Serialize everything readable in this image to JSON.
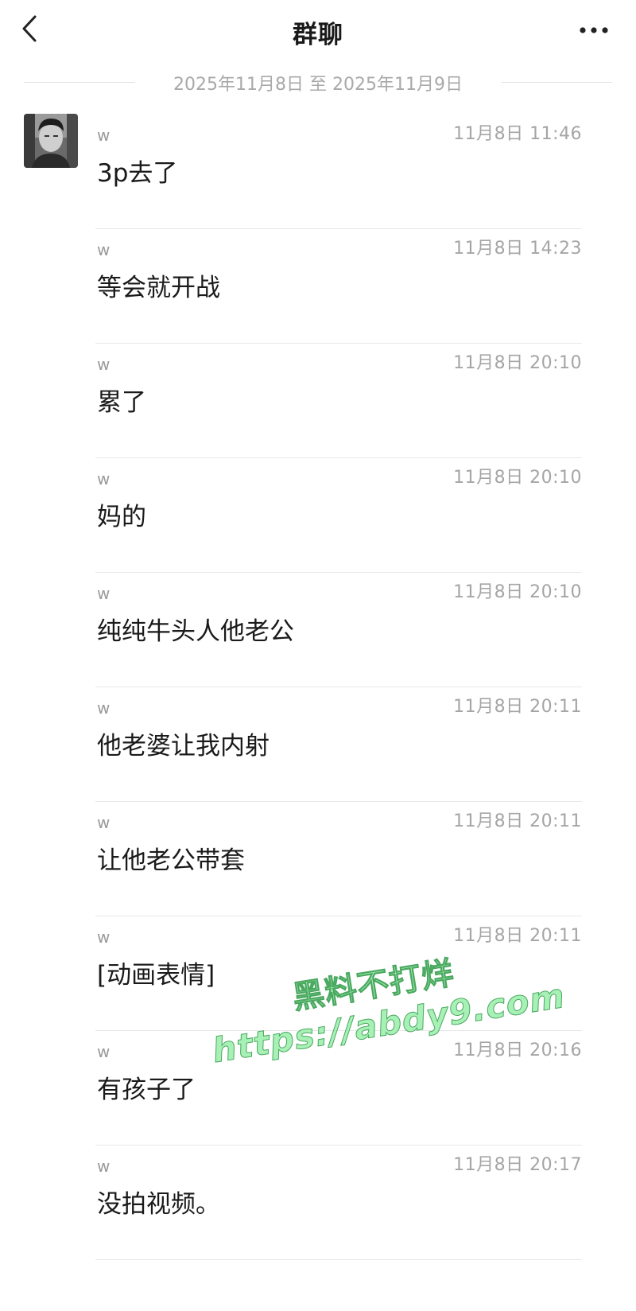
{
  "header": {
    "title": "群聊",
    "back_icon": "chevron-left-icon",
    "more_icon": "more-horizontal-icon"
  },
  "date_range": "2025年11月8日 至 2025年11月9日",
  "messages": [
    {
      "sender": "w",
      "time": "11月8日 11:46",
      "content": "3p去了"
    },
    {
      "sender": "w",
      "time": "11月8日 14:23",
      "content": "等会就开战"
    },
    {
      "sender": "w",
      "time": "11月8日 20:10",
      "content": "累了"
    },
    {
      "sender": "w",
      "time": "11月8日 20:10",
      "content": "妈的"
    },
    {
      "sender": "w",
      "time": "11月8日 20:10",
      "content": "纯纯牛头人他老公"
    },
    {
      "sender": "w",
      "time": "11月8日 20:11",
      "content": "他老婆让我内射"
    },
    {
      "sender": "w",
      "time": "11月8日 20:11",
      "content": "让他老公带套"
    },
    {
      "sender": "w",
      "time": "11月8日 20:11",
      "content": "[动画表情]"
    },
    {
      "sender": "w",
      "time": "11月8日 20:16",
      "content": "有孩子了"
    },
    {
      "sender": "w",
      "time": "11月8日 20:17",
      "content": "没拍视频。"
    }
  ],
  "watermark": {
    "line1": "黑料不打烊",
    "line2": "https://abdy9.com",
    "color": "#a8f1b6"
  }
}
